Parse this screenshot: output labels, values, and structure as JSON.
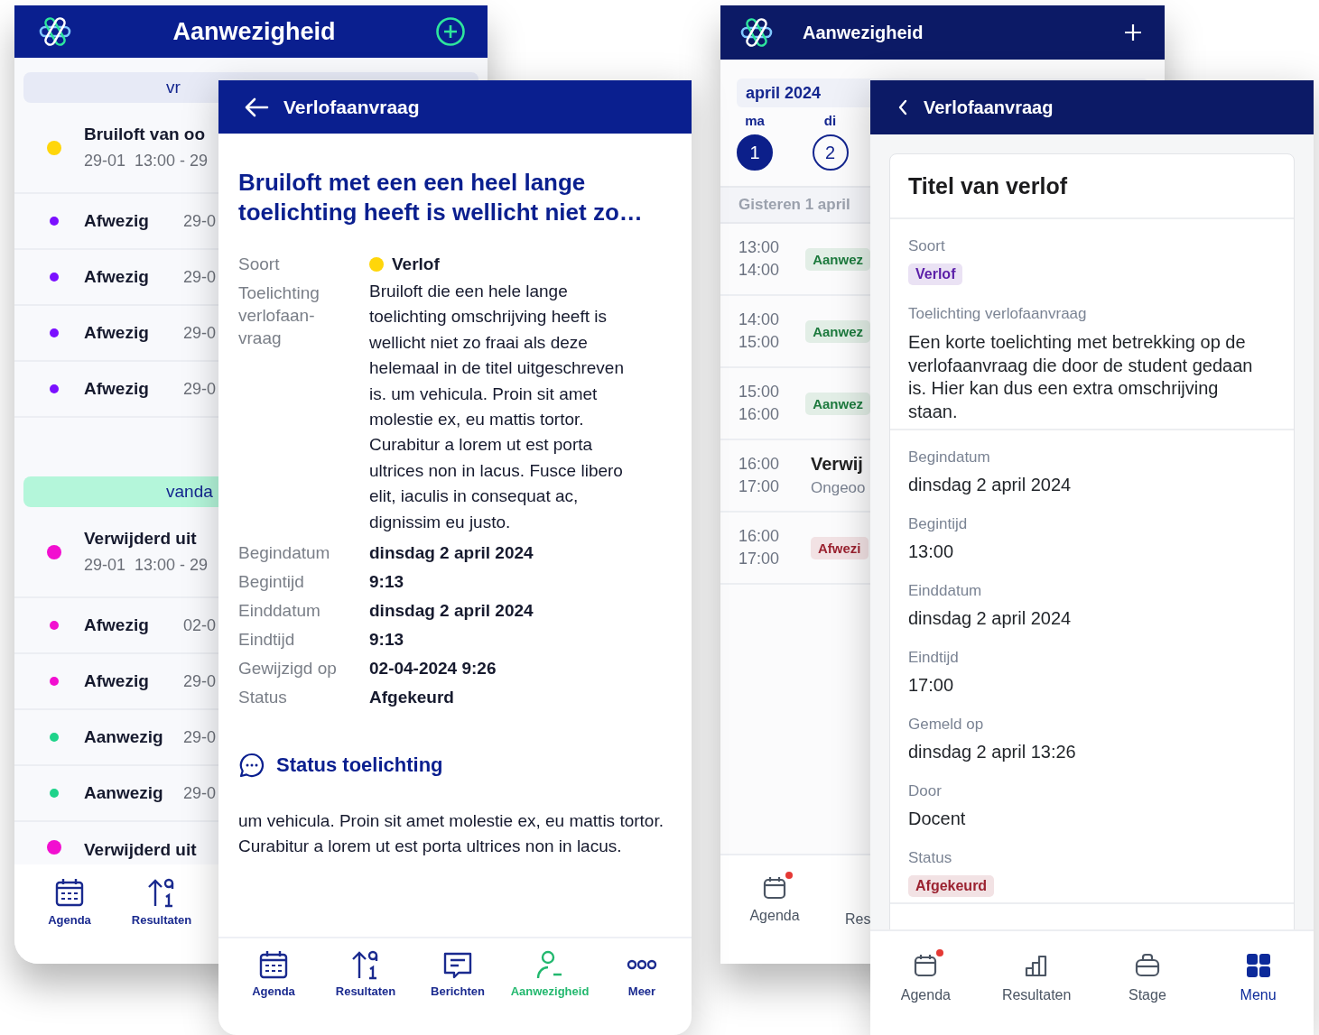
{
  "screens": [
    {
      "kind": "list",
      "header": {
        "title": "Aanwezigheid"
      },
      "sections": [
        {
          "date": "vr",
          "color": "#e7eaf6",
          "rows": [
            {
              "kind": "event",
              "title": "Bruiloft van oo",
              "subtitle": "29-01  13:00 - 29",
              "color": "#ffd60a"
            },
            {
              "kind": "status",
              "title": "Afwezig",
              "date": "29-0",
              "color": "#7b10ff"
            },
            {
              "kind": "status",
              "title": "Afwezig",
              "date": "29-0",
              "color": "#7b10ff"
            },
            {
              "kind": "status",
              "title": "Afwezig",
              "date": "29-0",
              "color": "#7b10ff"
            },
            {
              "kind": "status",
              "title": "Afwezig",
              "date": "29-0",
              "color": "#7b10ff"
            }
          ]
        },
        {
          "date": "vanda",
          "color": "#b4f6da",
          "rows": [
            {
              "kind": "event",
              "title": "Verwijderd uit",
              "subtitle": "29-01  13:00 - 29",
              "color": "#f20fd0"
            },
            {
              "kind": "status",
              "title": "Afwezig",
              "date": "02-0",
              "color": "#f20fd0"
            },
            {
              "kind": "status",
              "title": "Afwezig",
              "date": "29-0",
              "color": "#f20fd0"
            },
            {
              "kind": "status",
              "title": "Aanwezig",
              "date": "29-0",
              "color": "#1fd38a"
            },
            {
              "kind": "status",
              "title": "Aanwezig",
              "date": "29-0",
              "color": "#1fd38a"
            },
            {
              "kind": "event",
              "title": "Verwijderd uit",
              "color": "#f20fd0"
            }
          ]
        }
      ],
      "nav": [
        {
          "label": "Agenda",
          "selected": false
        },
        {
          "label": "Resultaten",
          "selected": false
        }
      ]
    },
    {
      "kind": "detail",
      "header": {
        "title": "Verlofaanvraag"
      },
      "title": "Bruiloft met een een heel lange toelichting heeft is wellicht niet zo…",
      "fields": [
        {
          "kind": "type",
          "label": "Soort",
          "value": "Verlof",
          "color": "#ffd60a"
        },
        {
          "kind": "text",
          "label": "Toelichting verlofaan-vraag",
          "value": "Bruiloft die een hele lange toelichting omschrijving heeft is wellicht niet zo fraai als deze helemaal in de titel uitgeschreven is. um vehicula. Proin sit amet molestie ex, eu mattis tortor. Curabitur a lorem ut est porta ultrices non in lacus. Fusce libero elit, iaculis in consequat ac, dignissim eu justo."
        },
        {
          "kind": "value",
          "label": "Begindatum",
          "value": "dinsdag 2 april 2024"
        },
        {
          "kind": "value",
          "label": "Begintijd",
          "value": "9:13"
        },
        {
          "kind": "value",
          "label": "Einddatum",
          "value": "dinsdag 2 april 2024"
        },
        {
          "kind": "value",
          "label": "Eindtijd",
          "value": "9:13"
        },
        {
          "kind": "value",
          "label": "Gewijzigd op",
          "value": "02-04-2024  9:26"
        },
        {
          "kind": "value",
          "label": "Status",
          "value": "Afgekeurd"
        }
      ],
      "status_note": {
        "heading": "Status toelichting",
        "text": "um vehicula. Proin sit amet molestie ex, eu mattis tortor. Curabitur a lorem ut est porta ultrices non in lacus."
      },
      "nav": [
        {
          "label": "Agenda",
          "selected": false
        },
        {
          "label": "Resultaten",
          "selected": false
        },
        {
          "label": "Berichten",
          "selected": false
        },
        {
          "label": "Aanwezigheid",
          "selected": true
        },
        {
          "label": "Meer",
          "selected": false
        }
      ]
    },
    {
      "kind": "calendar",
      "header": {
        "title": "Aanwezigheid"
      },
      "month": "april 2024",
      "days": [
        {
          "weekday": "ma",
          "number": "1",
          "selected": true
        },
        {
          "weekday": "di",
          "number": "2",
          "selected": false
        }
      ],
      "day_heading": "Gisteren 1 april",
      "slots": [
        {
          "kind": "chip",
          "start": "13:00",
          "end": "14:00",
          "label": "Aanwez",
          "color": "#1d7a3e"
        },
        {
          "kind": "chip",
          "start": "14:00",
          "end": "15:00",
          "label": "Aanwez",
          "color": "#1d7a3e"
        },
        {
          "kind": "chip",
          "start": "15:00",
          "end": "16:00",
          "label": "Aanwez",
          "color": "#1d7a3e"
        },
        {
          "kind": "event",
          "start": "16:00",
          "end": "17:00",
          "title": "Verwij",
          "subtitle": "Ongeoo"
        },
        {
          "kind": "chip",
          "start": "16:00",
          "end": "17:00",
          "label": "Afwezi",
          "color": "#9b2230"
        }
      ],
      "nav": [
        {
          "label": "Agenda",
          "badge": true,
          "selected": false
        },
        {
          "label": "Res",
          "badge": false,
          "selected": false
        }
      ]
    },
    {
      "kind": "card_detail",
      "header": {
        "title": "Verlofaanvraag"
      },
      "card": {
        "title": "Titel van verlof",
        "groups": [
          [
            {
              "kind": "chip",
              "label": "Soort",
              "value": "Verlof",
              "color": "#5b1fa8"
            },
            {
              "kind": "text",
              "label": "Toelichting verlofaanvraag",
              "value": "Een korte toelichting met betrekking op de verlofaanvraag die door de student gedaan is. Hier kan dus een extra omschrijving staan."
            }
          ],
          [
            {
              "kind": "value",
              "label": "Begindatum",
              "value": "dinsdag 2 april 2024"
            },
            {
              "kind": "value",
              "label": "Begintijd",
              "value": "13:00"
            },
            {
              "kind": "value",
              "label": "Einddatum",
              "value": "dinsdag 2 april 2024"
            },
            {
              "kind": "value",
              "label": "Eindtijd",
              "value": "17:00"
            },
            {
              "kind": "value",
              "label": "Gemeld op",
              "value": "dinsdag 2 april 13:26"
            },
            {
              "kind": "value",
              "label": "Door",
              "value": "Docent"
            },
            {
              "kind": "chip",
              "label": "Status",
              "value": "Afgekeurd",
              "color": "#9b2230"
            }
          ]
        ]
      },
      "nav": [
        {
          "label": "Agenda",
          "badge": true,
          "selected": false
        },
        {
          "label": "Resultaten",
          "badge": false,
          "selected": false
        },
        {
          "label": "Stage",
          "badge": false,
          "selected": false
        },
        {
          "label": "Menu",
          "badge": false,
          "selected": true
        }
      ]
    }
  ]
}
